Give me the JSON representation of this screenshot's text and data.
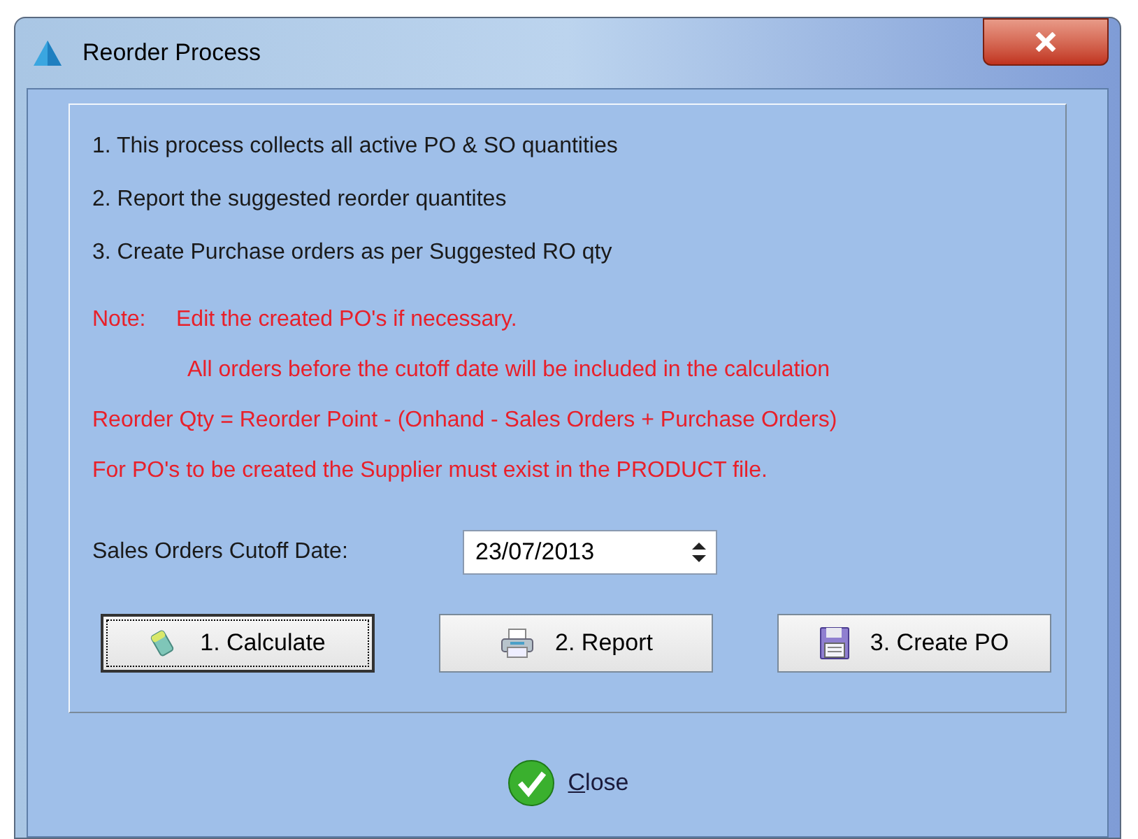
{
  "window": {
    "title": "Reorder Process"
  },
  "steps": [
    "1. This process collects all active PO & SO quantities",
    "2. Report the suggested reorder quantites",
    "3. Create Purchase orders  as per Suggested RO qty"
  ],
  "notes": [
    {
      "label": "Note:",
      "text": "Edit the created PO's if necessary."
    },
    {
      "text": "All orders before the cutoff date will be included in the calculation"
    },
    {
      "text": "Reorder Qty = Reorder Point - (Onhand - Sales Orders + Purchase Orders)"
    },
    {
      "text": "For PO's to be created the Supplier must exist in  the PRODUCT file."
    }
  ],
  "cutoff": {
    "label": "Sales Orders Cutoff Date:",
    "value": "23/07/2013"
  },
  "buttons": [
    {
      "label": "1. Calculate",
      "kind": "calculate",
      "focused": true
    },
    {
      "label": "2. Report",
      "kind": "report",
      "focused": false
    },
    {
      "label": "3. Create PO",
      "kind": "create",
      "focused": false
    }
  ],
  "close": {
    "label": "Close"
  }
}
